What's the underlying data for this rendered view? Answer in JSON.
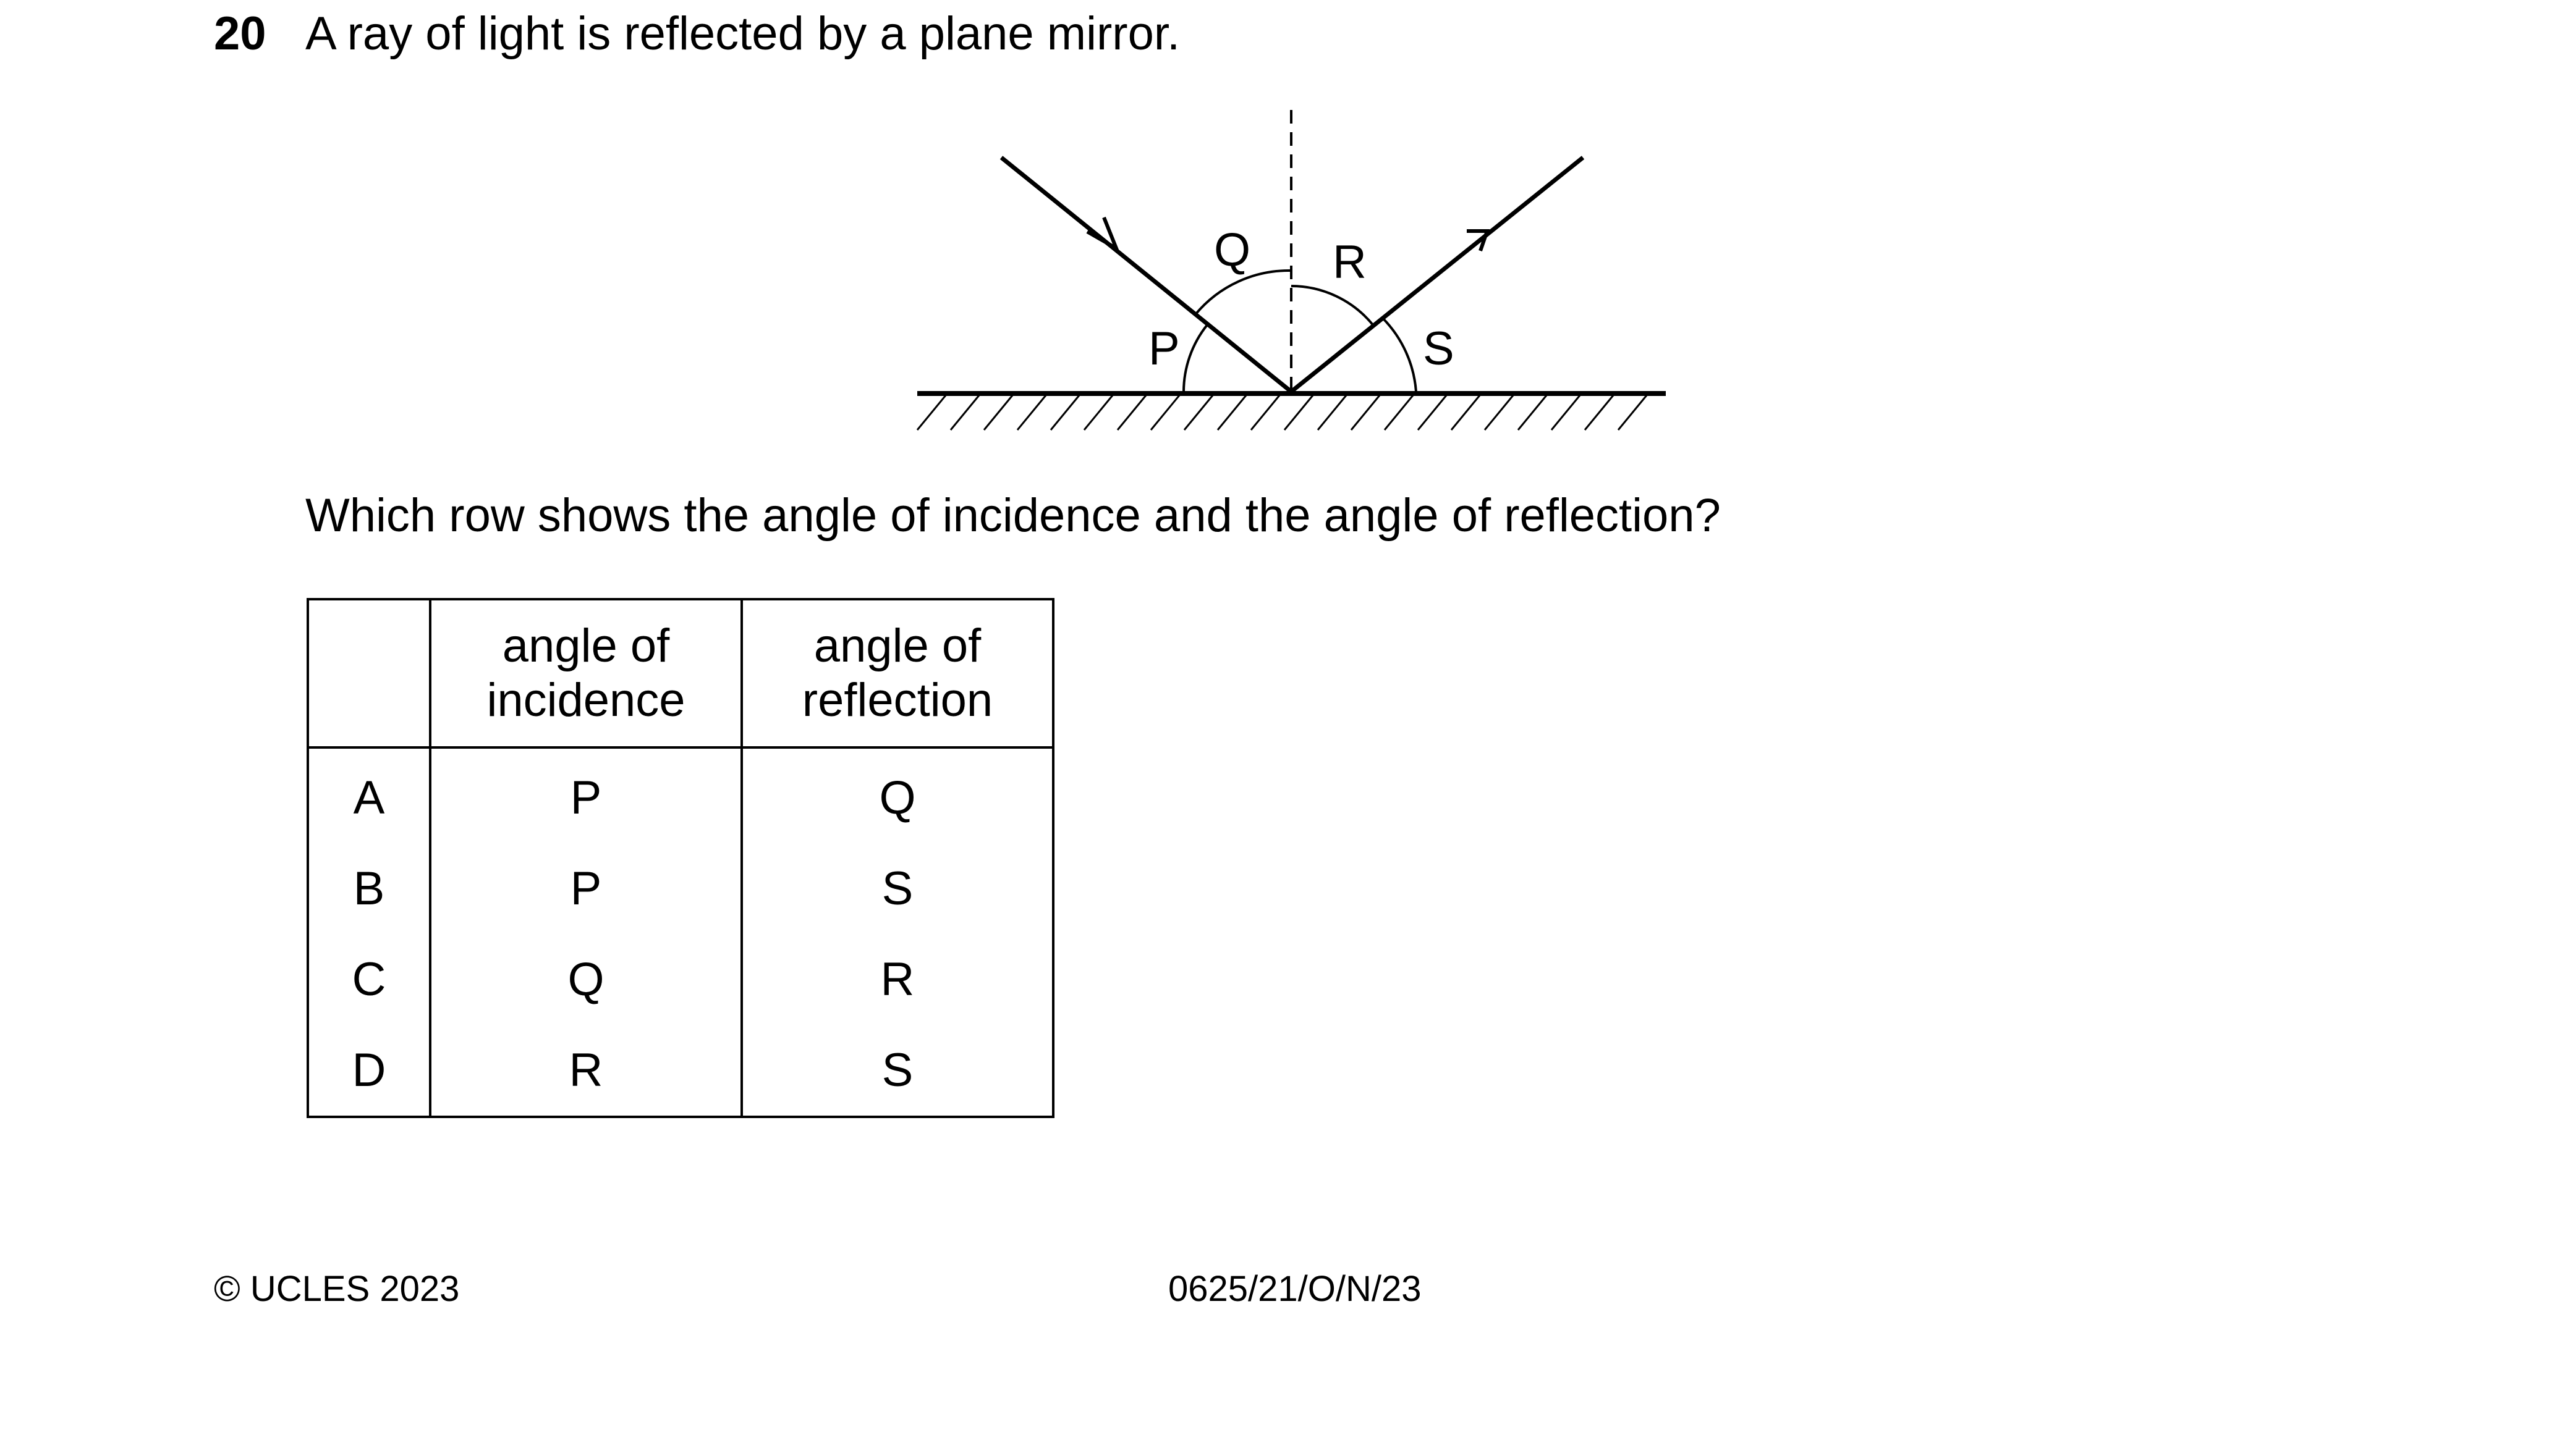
{
  "question": {
    "number": "20",
    "text": "A ray of light is reflected by a plane mirror.",
    "prompt": "Which row shows the angle of incidence and the angle of reflection?"
  },
  "diagram": {
    "angle_labels": {
      "p": "P",
      "q": "Q",
      "r": "R",
      "s": "S"
    }
  },
  "table": {
    "headers": [
      "",
      "angle of\nincidence",
      "angle of\nreflection"
    ],
    "header_incidence": [
      "angle of",
      "incidence"
    ],
    "header_reflection": [
      "angle of",
      "reflection"
    ],
    "rows": [
      {
        "option": "A",
        "incidence": "P",
        "reflection": "Q"
      },
      {
        "option": "B",
        "incidence": "P",
        "reflection": "S"
      },
      {
        "option": "C",
        "incidence": "Q",
        "reflection": "R"
      },
      {
        "option": "D",
        "incidence": "R",
        "reflection": "S"
      }
    ]
  },
  "footer": {
    "copyright": "© UCLES 2023",
    "paper_code": "0625/21/O/N/23"
  }
}
